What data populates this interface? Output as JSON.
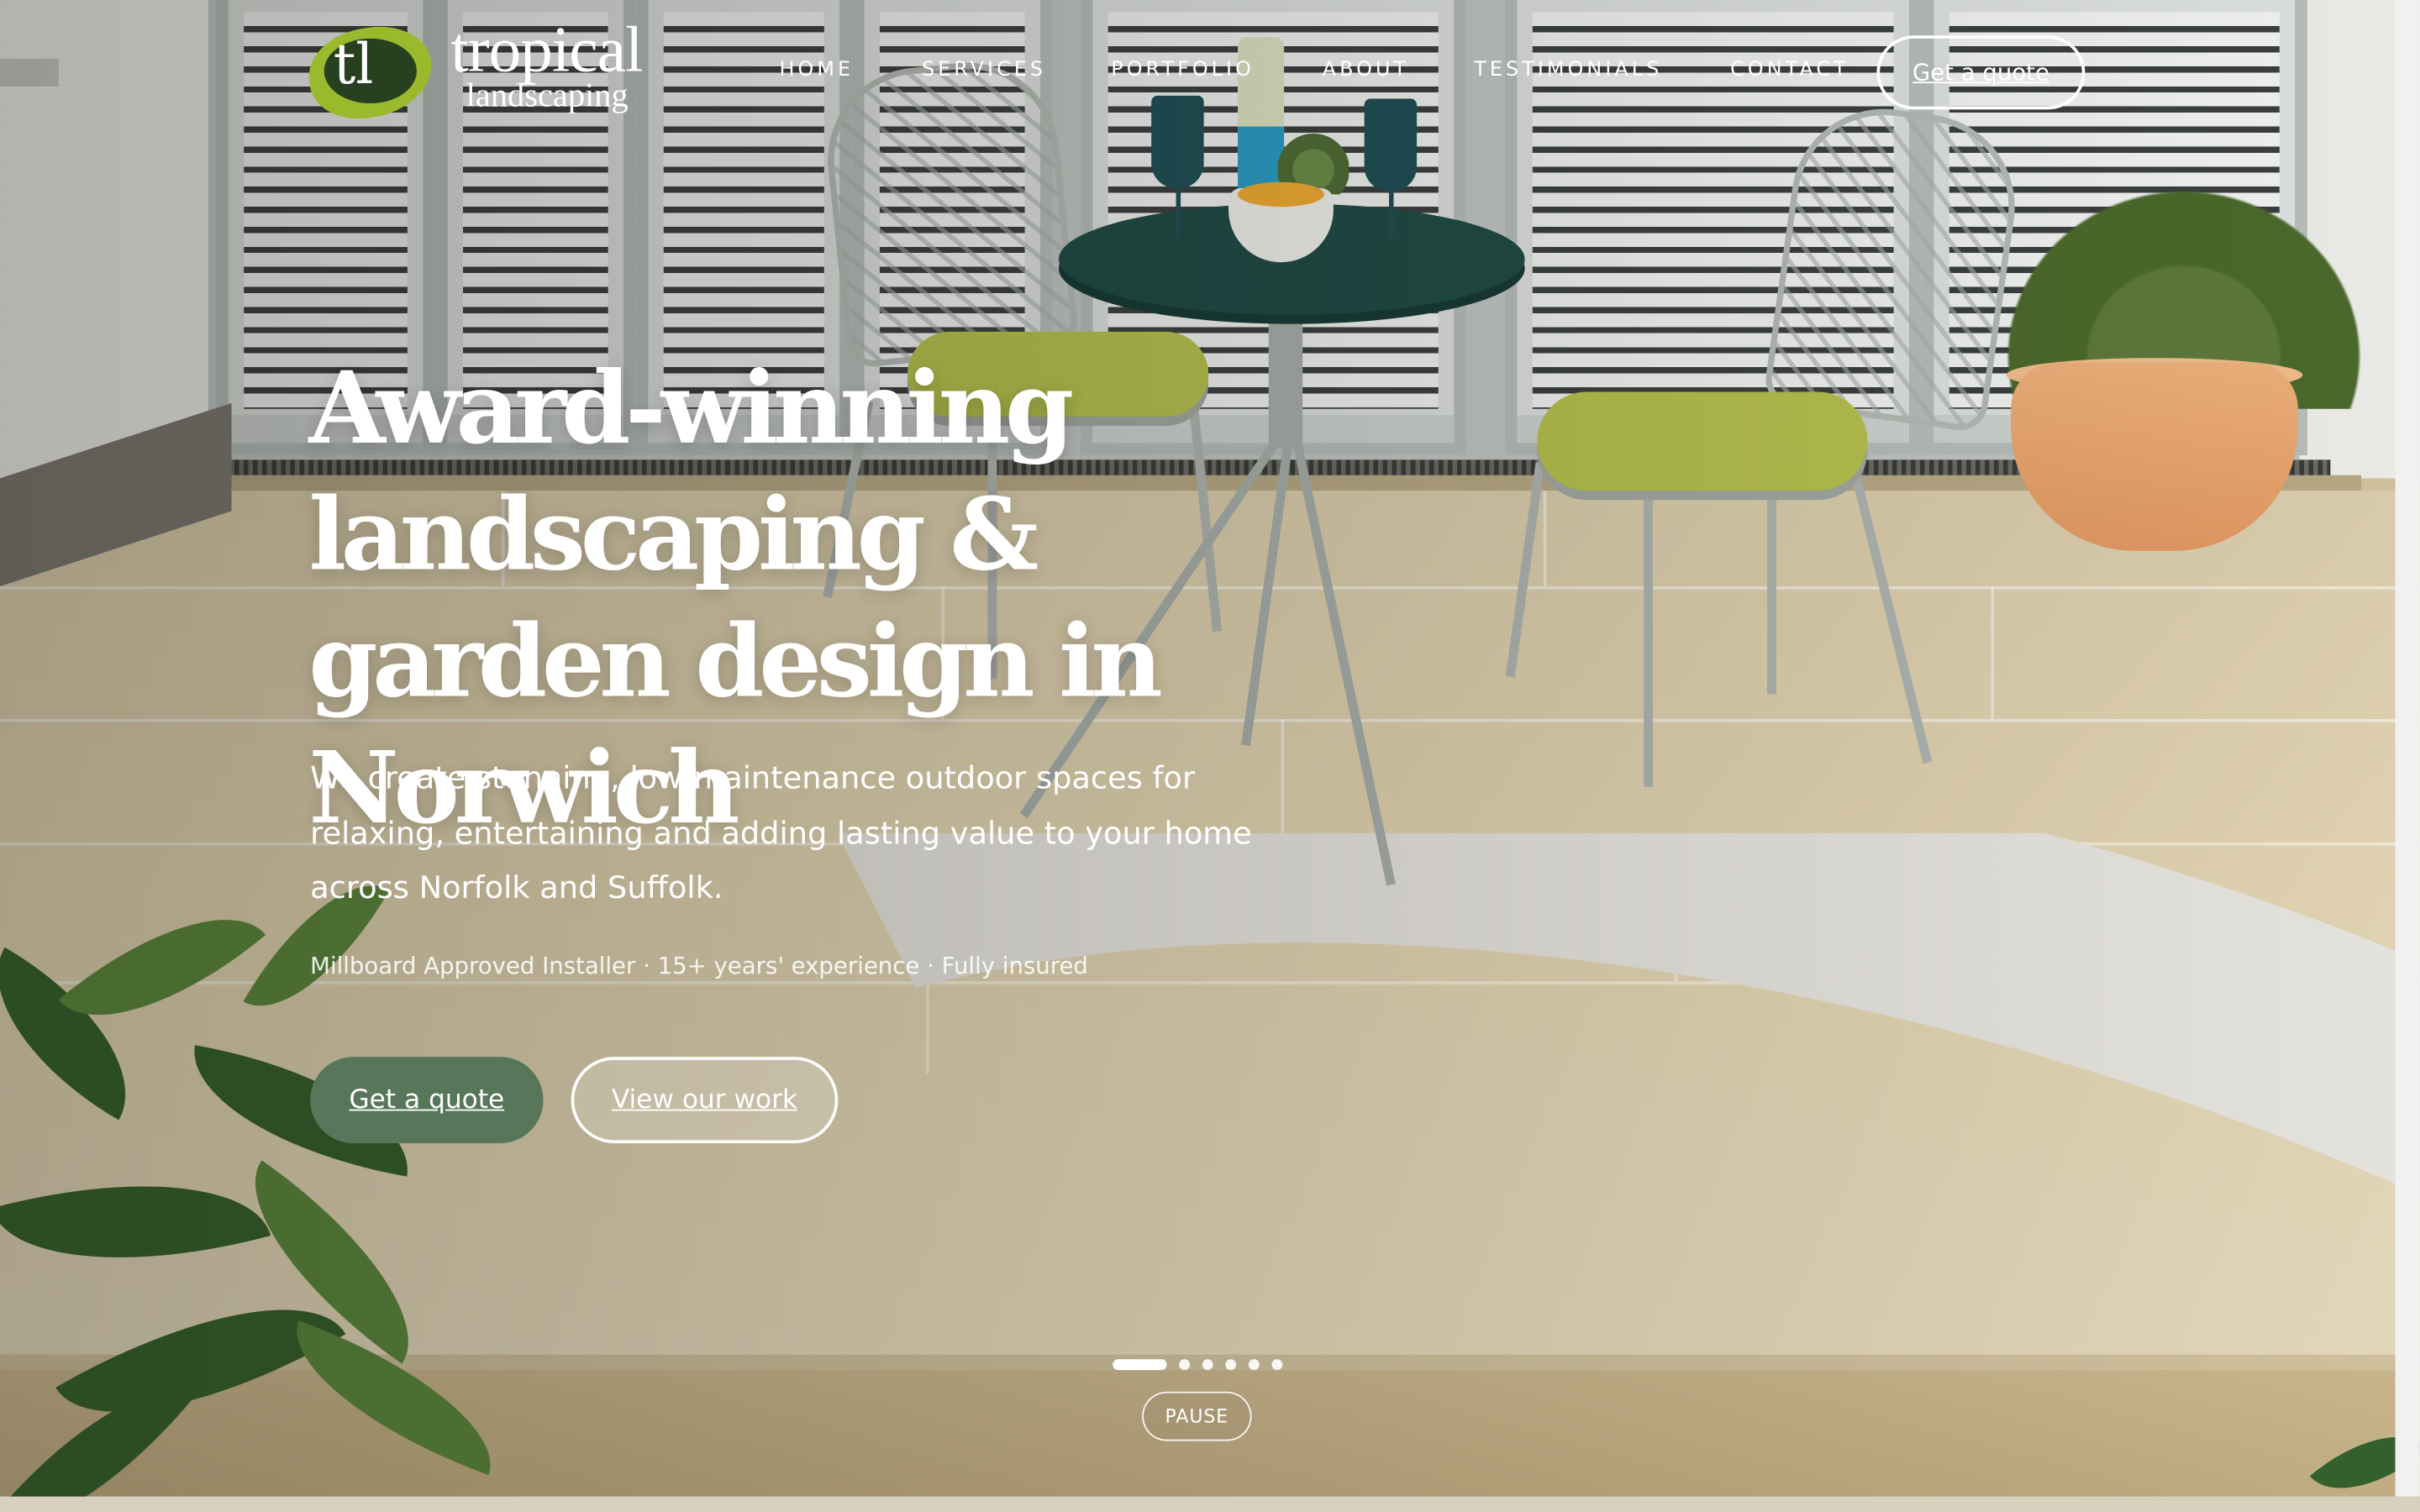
{
  "brand": {
    "monogram": "tl",
    "name": "tropical",
    "tagline": "landscaping"
  },
  "nav": {
    "items": [
      "HOME",
      "SERVICES",
      "PORTFOLIO",
      "ABOUT",
      "TESTIMONIALS",
      "CONTACT"
    ],
    "cta_label": "Get a quote"
  },
  "hero": {
    "title": "Award-winning landscaping & garden design in Norwich",
    "subtitle": "We create stunning, low-maintenance outdoor spaces for relaxing, entertaining and adding lasting value to your home across Norfolk and Suffolk.",
    "trust_line": "Millboard Approved Installer · 15+ years' experience · Fully insured",
    "primary_cta": "Get a quote",
    "secondary_cta": "View our work"
  },
  "slider": {
    "slide_count": 6,
    "active_index": 0,
    "pause_label": "PAUSE"
  },
  "colors": {
    "accent_green": "#58775a",
    "logo_leaf": "#9ab92c",
    "text_on_image": "#ffffff"
  }
}
